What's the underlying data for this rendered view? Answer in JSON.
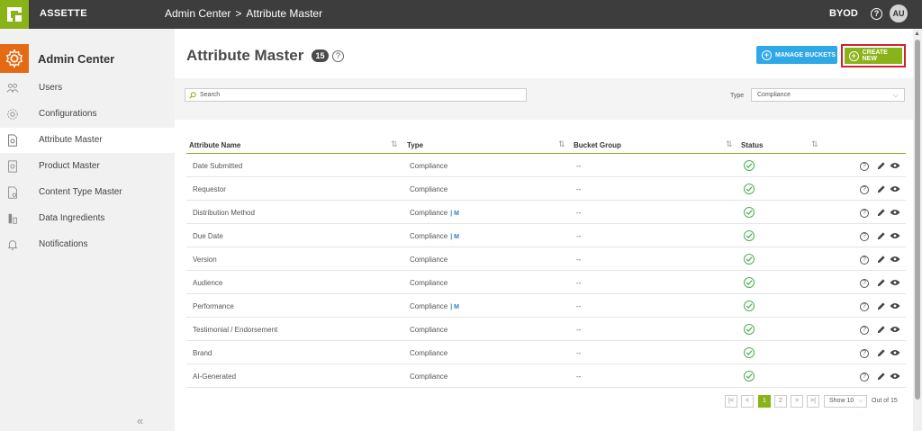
{
  "topbar": {
    "brand": "ASSETTE",
    "breadcrumb_root": "Admin Center",
    "breadcrumb_sep": ">",
    "breadcrumb_current": "Attribute Master",
    "workspace": "BYOD",
    "help_glyph": "?",
    "avatar_initials": "AU"
  },
  "sidebar": {
    "title": "Admin Center",
    "items": [
      {
        "label": "Users",
        "icon": "users-icon",
        "active": false
      },
      {
        "label": "Configurations",
        "icon": "gear-icon",
        "active": false
      },
      {
        "label": "Attribute Master",
        "icon": "document-gear-icon",
        "active": true
      },
      {
        "label": "Product Master",
        "icon": "product-icon",
        "active": false
      },
      {
        "label": "Content Type Master",
        "icon": "file-gear-icon",
        "active": false
      },
      {
        "label": "Data Ingredients",
        "icon": "ingredients-icon",
        "active": false
      },
      {
        "label": "Notifications",
        "icon": "bell-icon",
        "active": false
      }
    ],
    "collapse_glyph": "«"
  },
  "main": {
    "title": "Attribute Master",
    "count": "15",
    "manage_buckets_label": "MANAGE BUCKETS",
    "create_new_label": "CREATE NEW",
    "search_placeholder": "Search",
    "type_label": "Type",
    "type_value": "Compliance",
    "columns": [
      "Attribute Name",
      "Type",
      "Bucket Group",
      "Status"
    ],
    "rows": [
      {
        "name": "Date Submitted",
        "type": "Compliance",
        "m": "",
        "bucket": "--"
      },
      {
        "name": "Requestor",
        "type": "Compliance",
        "m": "",
        "bucket": "--"
      },
      {
        "name": "Distribution Method",
        "type": "Compliance",
        "m": "| M",
        "bucket": "--"
      },
      {
        "name": "Due Date",
        "type": "Compliance",
        "m": "| M",
        "bucket": "--"
      },
      {
        "name": "Version",
        "type": "Compliance",
        "m": "",
        "bucket": "--"
      },
      {
        "name": "Audience",
        "type": "Compliance",
        "m": "",
        "bucket": "--"
      },
      {
        "name": "Performance",
        "type": "Compliance",
        "m": "| M",
        "bucket": "--"
      },
      {
        "name": "Testimonial / Endorsement",
        "type": "Compliance",
        "m": "",
        "bucket": "--"
      },
      {
        "name": "Brand",
        "type": "Compliance",
        "m": "",
        "bucket": "--"
      },
      {
        "name": "AI-Generated",
        "type": "Compliance",
        "m": "",
        "bucket": "--"
      }
    ],
    "pagination": {
      "first": "|<",
      "prev": "<",
      "pages": [
        "1",
        "2"
      ],
      "current": "1",
      "next": ">",
      "last": ">|",
      "show_label": "Show 10",
      "out_of": "Out of 15"
    }
  },
  "colors": {
    "accent_green": "#8ab31a",
    "accent_orange": "#e56a14",
    "button_blue": "#2ea8e6",
    "highlight_red": "#d51f2b",
    "topbar": "#3d3d3d"
  }
}
